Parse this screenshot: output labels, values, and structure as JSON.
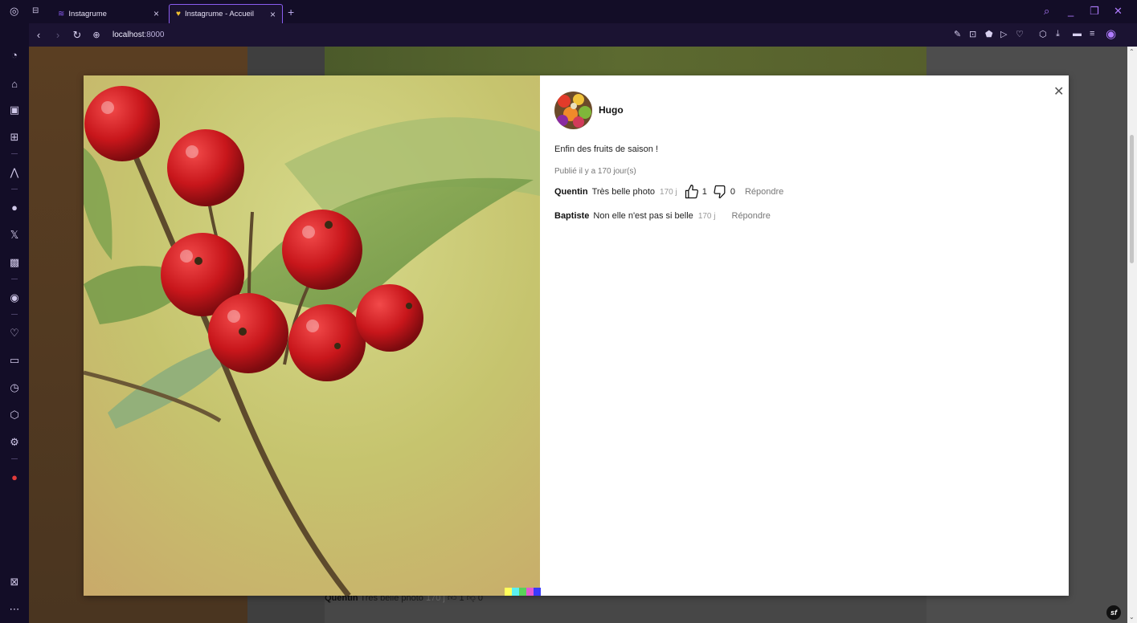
{
  "browser": {
    "tabs": [
      {
        "label": "Instagrume",
        "active": false
      },
      {
        "label": "Instagrume - Accueil",
        "active": true
      }
    ],
    "url_host": "localhost",
    "url_port": ":8000"
  },
  "post": {
    "author": "Hugo",
    "caption": "Enfin des fruits de saison !",
    "posted": "Publié il y a 170 jour(s)",
    "comments": [
      {
        "user": "Quentin",
        "text": "Très belle photo",
        "age": "170 j",
        "likes": "1",
        "dislikes": "0",
        "reply": "Répondre",
        "has_votes": true
      },
      {
        "user": "Baptiste",
        "text": "Non elle n'est pas si belle",
        "age": "170 j",
        "reply": "Répondre",
        "has_votes": false
      }
    ]
  },
  "background_comment": {
    "user": "Quentin",
    "text": "Très belle photo",
    "age": "170 j",
    "likes": "1",
    "dislikes": "0"
  },
  "colors": {
    "accent": "#8a5cf0",
    "chrome": "#130d27",
    "berry": "#c8161b"
  }
}
